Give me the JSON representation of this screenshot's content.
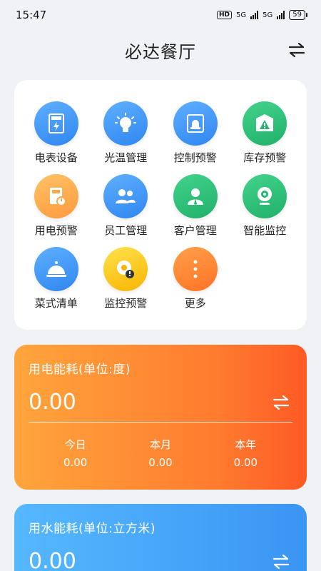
{
  "status_bar": {
    "time": "15:47",
    "network1": "5G",
    "network2": "5G",
    "hd": "HD",
    "battery": "59"
  },
  "header": {
    "title": "必达餐厅",
    "switch_icon": "swap-arrows-icon"
  },
  "grid": {
    "items": [
      {
        "label": "电表设备",
        "icon": "meter-icon",
        "color": "#3b93f5"
      },
      {
        "label": "光温管理",
        "icon": "bulb-icon",
        "color": "#3b93f5"
      },
      {
        "label": "控制预警",
        "icon": "alarm-light-icon",
        "color": "#3b93f5"
      },
      {
        "label": "库存预警",
        "icon": "box-warning-icon",
        "color": "#22b66f"
      },
      {
        "label": "用电预警",
        "icon": "power-alert-icon",
        "color": "#ffa84a"
      },
      {
        "label": "员工管理",
        "icon": "users-icon",
        "color": "#3b93f5"
      },
      {
        "label": "客户管理",
        "icon": "user-icon",
        "color": "#22b66f"
      },
      {
        "label": "智能监控",
        "icon": "webcam-icon",
        "color": "#22b66f"
      },
      {
        "label": "菜式清单",
        "icon": "cloche-icon",
        "color": "#3b93f5"
      },
      {
        "label": "监控预警",
        "icon": "camera-warning-icon",
        "color": "#f7b500"
      },
      {
        "label": "更多",
        "icon": "more-vertical-icon",
        "color": "#ff7a2a"
      }
    ]
  },
  "electricity": {
    "title": "用电能耗(单位:度)",
    "value": "0.00",
    "stats": [
      {
        "label": "今日",
        "value": "0.00"
      },
      {
        "label": "本月",
        "value": "0.00"
      },
      {
        "label": "本年",
        "value": "0.00"
      }
    ]
  },
  "water": {
    "title": "用水能耗(单位:立方米)",
    "value": "0.00"
  },
  "colors": {
    "background": "#f1f2f6",
    "electricity_card": "#ff8a33",
    "water_card": "#4aa6f8"
  }
}
